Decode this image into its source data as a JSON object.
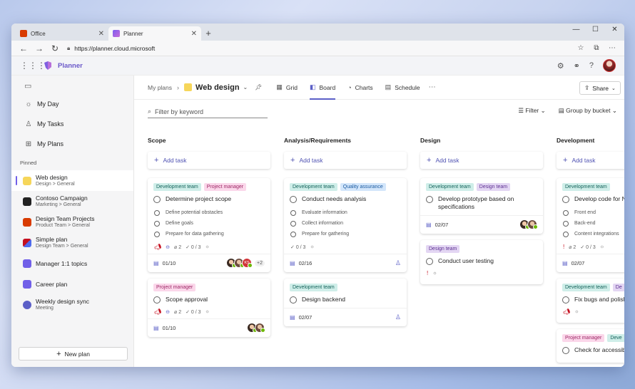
{
  "browser": {
    "tabs": [
      {
        "label": "Office"
      },
      {
        "label": "Planner"
      }
    ],
    "url": "https://planner.cloud.microsoft"
  },
  "app": {
    "name": "Planner"
  },
  "sidebar": {
    "nav": [
      {
        "label": "My Day"
      },
      {
        "label": "My Tasks"
      },
      {
        "label": "My Plans"
      }
    ],
    "pinned_header": "Pinned",
    "pinned": [
      {
        "title": "Web design",
        "sub": "Design > General",
        "color": "#f6d65a"
      },
      {
        "title": "Contoso Campaign",
        "sub": "Marketing > General",
        "color": "#222222"
      },
      {
        "title": "Design Team Projects",
        "sub": "Product Team > General",
        "color": "#d83b01"
      },
      {
        "title": "Simple plan",
        "sub": "Design Team > General",
        "color": "#c50f1f"
      },
      {
        "title": "Manager 1:1 topics",
        "sub": "",
        "color": "#7160e8"
      },
      {
        "title": "Career plan",
        "sub": "",
        "color": "#7160e8"
      },
      {
        "title": "Weekly design sync",
        "sub": "Meeting",
        "color": "#5b5fc7"
      }
    ],
    "new_plan": "New plan"
  },
  "header": {
    "breadcrumb": "My plans",
    "plan_title": "Web design",
    "views": [
      {
        "label": "Grid"
      },
      {
        "label": "Board"
      },
      {
        "label": "Charts"
      },
      {
        "label": "Schedule"
      }
    ],
    "share": "Share"
  },
  "toolbar": {
    "filter_placeholder": "Filter by keyword",
    "filter": "Filter",
    "group_by": "Group by bucket"
  },
  "board": {
    "add_task": "Add task",
    "buckets": [
      {
        "name": "Scope",
        "cards": [
          {
            "labels": [
              "Development team",
              "Project manager"
            ],
            "title": "Determine project scope",
            "checklist": [
              "Define potential obstacles",
              "Define goals",
              "Prepare for data gathering"
            ],
            "attachments": "2",
            "progress": "0 / 3",
            "date": "01/10",
            "more": "+2"
          },
          {
            "labels": [
              "Project manager"
            ],
            "title": "Scope approval",
            "attachments": "2",
            "progress": "0 / 3",
            "date": "01/10"
          }
        ]
      },
      {
        "name": "Analysis/Requirements",
        "cards": [
          {
            "labels": [
              "Development team",
              "Quality assurance"
            ],
            "title": "Conduct needs analysis",
            "checklist": [
              "Evaluate information",
              "Collect information",
              "Prepare for gathering"
            ],
            "progress": "0 / 3",
            "date": "02/16"
          },
          {
            "labels": [
              "Development team"
            ],
            "title": "Design backend",
            "date": "02/07"
          }
        ]
      },
      {
        "name": "Design",
        "cards": [
          {
            "labels": [
              "Development team",
              "Design team"
            ],
            "title": "Develop prototype based on specifications",
            "date": "02/07"
          },
          {
            "labels": [
              "Design team"
            ],
            "title": "Conduct user testing"
          }
        ]
      },
      {
        "name": "Development",
        "cards": [
          {
            "labels": [
              "Development team"
            ],
            "title": "Develop code for N",
            "checklist": [
              "Front end",
              "Back-end",
              "Content integrations"
            ],
            "attachments": "2",
            "progress": "0 / 3",
            "date": "02/07"
          },
          {
            "labels": [
              "Development team",
              "De"
            ],
            "title": "Fix bugs and polish"
          },
          {
            "labels": [
              "Project manager",
              "Deve"
            ],
            "title": "Check for accessibi"
          }
        ]
      }
    ]
  }
}
